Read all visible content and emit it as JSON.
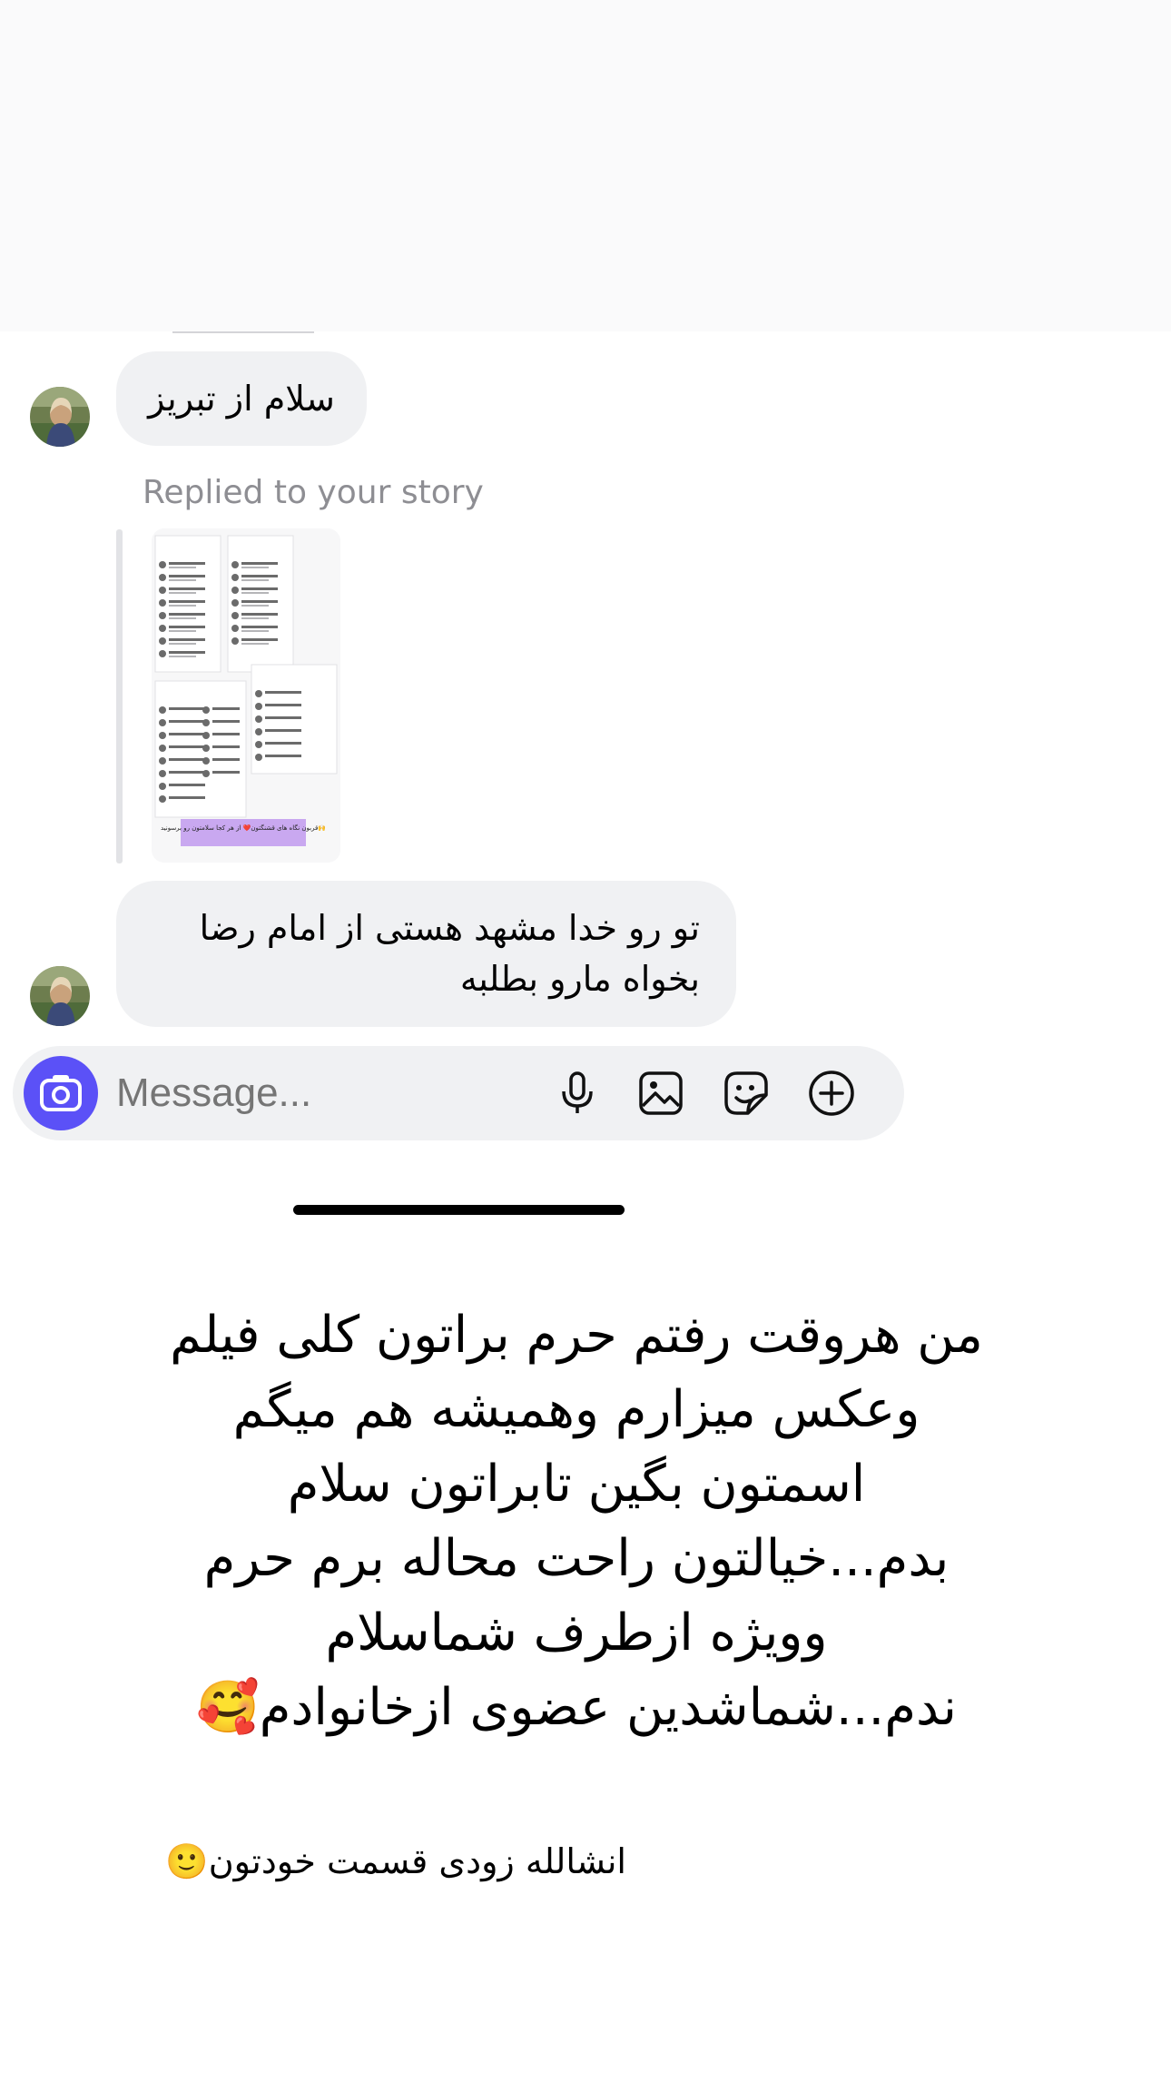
{
  "conversation": {
    "messages": [
      {
        "text": "سلام از تبریز"
      },
      {
        "context": "Replied to your story",
        "story_banner": "قربون نگاه های قشنگتون❤️ از هر کجا سلامتون رو برسونید🙌"
      },
      {
        "text": "تو رو خدا مشهد هستی از امام رضا بخواه مارو بطلبه"
      }
    ]
  },
  "composer": {
    "placeholder": "Message...",
    "icons": [
      "camera-icon",
      "microphone-icon",
      "gallery-icon",
      "sticker-icon",
      "plus-icon"
    ],
    "accent_color": "#5b51f7"
  },
  "caption": {
    "main": "من هروقت رفتم حرم براتون کلی فیلم\nوعکس میزارم وهمیشه هم میگم\nاسمتون بگین تابراتون سلام\nبدم...خیالتون راحت محاله برم حرم\nوویژه ازطرف شماسلام\nندم...شماشدین عضوی ازخانوادم🥰",
    "secondary": "انشالله زودی قسمت خودتون🙂"
  },
  "colors": {
    "bubble": "#f0f1f3",
    "secondary_text": "#8e8e93",
    "background": "#ffffff"
  }
}
